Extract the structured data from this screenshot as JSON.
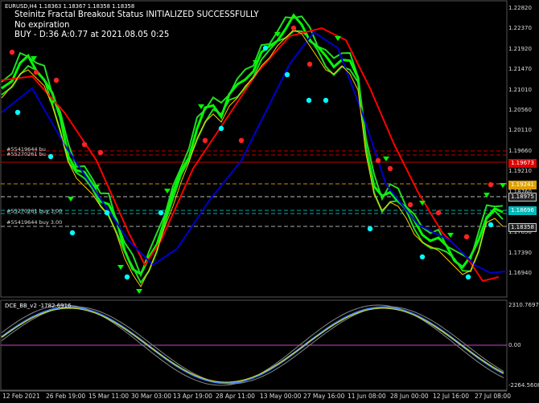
{
  "symbol_line": "EURUSD,H4  1.18363 1.18367 1.18358 1.18358",
  "status_lines": [
    "Steinitz Fractal Breakout Status INITIALIZED SUCCESSFULLY",
    "No expiration",
    "BUY - D:36 A:0.77 at 2021.08.05 0:25"
  ],
  "order_labels": [
    "#55419644 bu",
    "#55270261 bu",
    "#55270261 buy 3.00",
    "#55419644 buy 3.00"
  ],
  "y_ticks": [
    "1.22820",
    "1.22370",
    "1.21920",
    "1.21470",
    "1.21010",
    "1.20560",
    "1.20110",
    "1.19660",
    "1.19210",
    "1.18760",
    "1.18300",
    "1.17850",
    "1.17390",
    "1.16940"
  ],
  "price_boxes": [
    {
      "label": "1.19673",
      "color": "#e00000"
    },
    {
      "label": "1.19241",
      "color": "#e0a000"
    },
    {
      "label": "1.18975",
      "color": "#222222"
    },
    {
      "label": "1.18696",
      "color": "#00b8b8"
    },
    {
      "label": "1.18358",
      "color": "#222222"
    }
  ],
  "x_ticks": [
    "12 Feb 2021",
    "26 Feb 19:00",
    "15 Mar 11:00",
    "30 Mar 03:00",
    "13 Apr 19:00",
    "28 Apr 11:00",
    "13 May 00:00",
    "27 May 16:00",
    "11 Jun 08:00",
    "28 Jun 00:00",
    "12 Jul 16:00",
    "27 Jul 08:00"
  ],
  "sub_title": "DCE_BB_v2 -1782.6916",
  "sub_ticks": [
    "2310.7697",
    "0.00",
    "-2264.5608"
  ],
  "colors": {
    "bg": "#000000",
    "candle": "#00ff00",
    "ma_red": "#ff0000",
    "ma_blue": "#0000cc",
    "ma_yellow": "#ffcc00",
    "arrow_up": "#00ff00",
    "dot_red": "#ff0000",
    "dot_cyan": "#00ffff"
  }
}
